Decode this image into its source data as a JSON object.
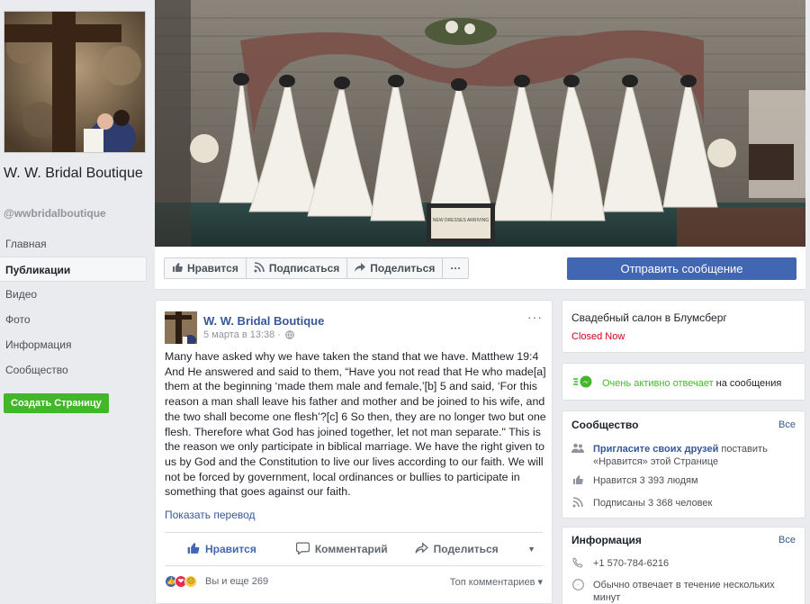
{
  "page": {
    "name": "W. W. Bridal Boutique",
    "handle": "@wwbridalboutique"
  },
  "left_nav": [
    {
      "label": "Главная"
    },
    {
      "label": "Публикации"
    },
    {
      "label": "Видео"
    },
    {
      "label": "Фото"
    },
    {
      "label": "Информация"
    },
    {
      "label": "Сообщество"
    }
  ],
  "create_page_label": "Создать Страницу",
  "cover": {
    "sign_text": "NEW DRESSES ARRIVING"
  },
  "cover_actions": {
    "like": "Нравится",
    "follow": "Подписаться",
    "share": "Поделиться",
    "more": "···",
    "send_message": "Отправить сообщение"
  },
  "post": {
    "author": "W. W. Bridal Boutique",
    "date": "5 марта в 13:38 ·",
    "more": "···",
    "text": "Many have asked why we have taken the stand that we have. Matthew 19:4 And He answered and said to them, “Have you not read that He who made[a] them at the beginning ‘made them male and female,’[b] 5 and said, ‘For this reason a man shall leave his father and mother and be joined to his wife, and the two shall become one flesh’?[c] 6 So then, they are no longer two but one flesh. Therefore what God has joined together, let not man separate.\" This is the reason we only participate in biblical marriage. We have the right given to us by God and the Constitution to live our lives according to our faith. We will not be forced by government, local ordinances or bullies to participate in something that goes against our faith.",
    "translate": "Показать перевод",
    "actions": {
      "like": "Нравится",
      "comment": "Комментарий",
      "share": "Поделиться"
    },
    "reactions_text": "Вы и еще 269",
    "top_comments": "Топ комментариев ▾"
  },
  "about_card": {
    "title": "Свадебный салон в Блумсберг",
    "status": "Closed Now"
  },
  "responsiveness": {
    "highlight": "Очень активно отвечает",
    "rest": " на сообщения"
  },
  "community": {
    "title": "Сообщество",
    "see_all": "Все",
    "invite_link": "Пригласите своих друзей",
    "invite_rest": " поставить «Нравится» этой Странице",
    "likes": "Нравится 3 393 людям",
    "follows": "Подписаны 3 368 человек"
  },
  "info": {
    "title": "Информация",
    "see_all": "Все",
    "phone": "+1 570-784-6216",
    "response": "Обычно отвечает в течение нескольких минут"
  },
  "colors": {
    "fb_blue": "#4267b2",
    "link": "#365899",
    "green": "#42b72a",
    "closed_red": "#d0021b"
  }
}
